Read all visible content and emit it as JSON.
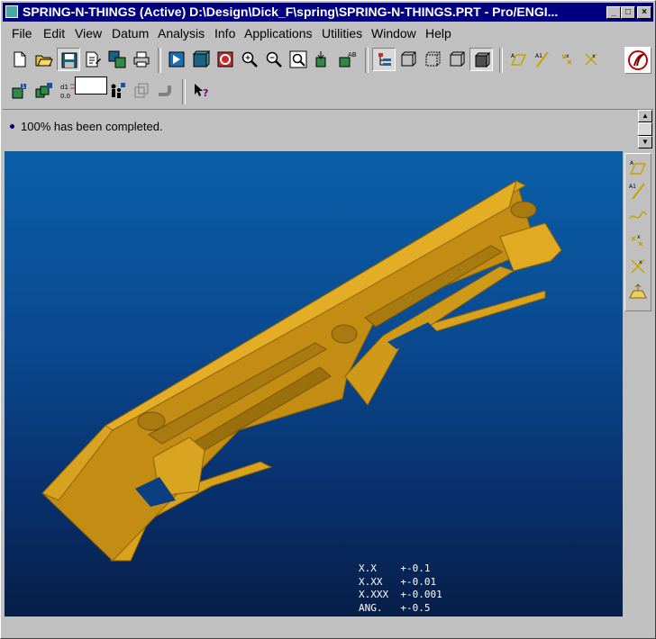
{
  "window": {
    "title": "SPRING-N-THINGS (Active)  D:\\Design\\Dick_F\\spring\\SPRING-N-THINGS.PRT - Pro/ENGI...",
    "minimize": "_",
    "maximize": "□",
    "close": "×"
  },
  "menu": [
    {
      "label": "File"
    },
    {
      "label": "Edit"
    },
    {
      "label": "View"
    },
    {
      "label": "Datum"
    },
    {
      "label": "Analysis"
    },
    {
      "label": "Info"
    },
    {
      "label": "Applications"
    },
    {
      "label": "Utilities"
    },
    {
      "label": "Window"
    },
    {
      "label": "Help"
    }
  ],
  "message": {
    "text": "100% has been completed."
  },
  "tolerances": [
    "X.X    +-0.1",
    "X.XX   +-0.01",
    "X.XXX  +-0.001",
    "ANG.   +-0.5"
  ],
  "colors": {
    "titlebar": "#000080",
    "part": "#d9a21b",
    "viewport_top": "#0a5fa8",
    "viewport_bottom": "#071e48"
  }
}
